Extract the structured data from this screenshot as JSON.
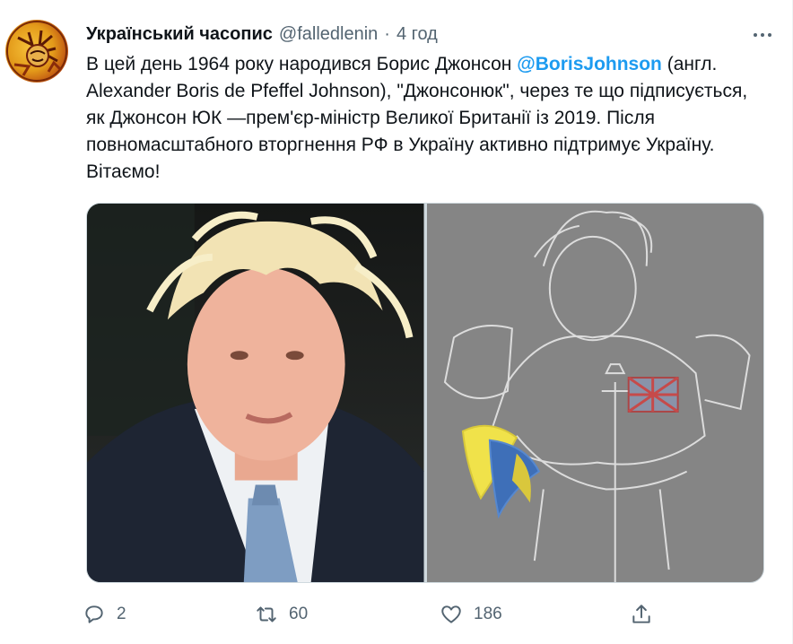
{
  "author": {
    "display_name": "Український часопис",
    "handle": "@falledlenin",
    "separator": "·",
    "time": "4 год"
  },
  "tweet": {
    "text_before_mention": "В цей день 1964 року народився Борис Джонсон ",
    "mention": "@BorisJohnson",
    "text_after_mention": " (англ. Alexander Boris de Pfeffel Johnson), \"Джонсонюк\", через те що підписується, як Джонсон ЮК —прем'єр-міністр Великої Британії із 2019. Після повномасштабного вторгнення РФ в Україну активно підтримує Україну. Вітаємо!"
  },
  "media": {
    "items": [
      {
        "icon": "photo-portrait",
        "description_hidden": ""
      },
      {
        "icon": "drawing-knight",
        "description_hidden": ""
      }
    ]
  },
  "actions": {
    "reply_count": "2",
    "retweet_count": "60",
    "like_count": "186"
  },
  "colors": {
    "accent": "#1d9bf0",
    "secondary_text": "#536471",
    "primary_text": "#0f1419"
  }
}
